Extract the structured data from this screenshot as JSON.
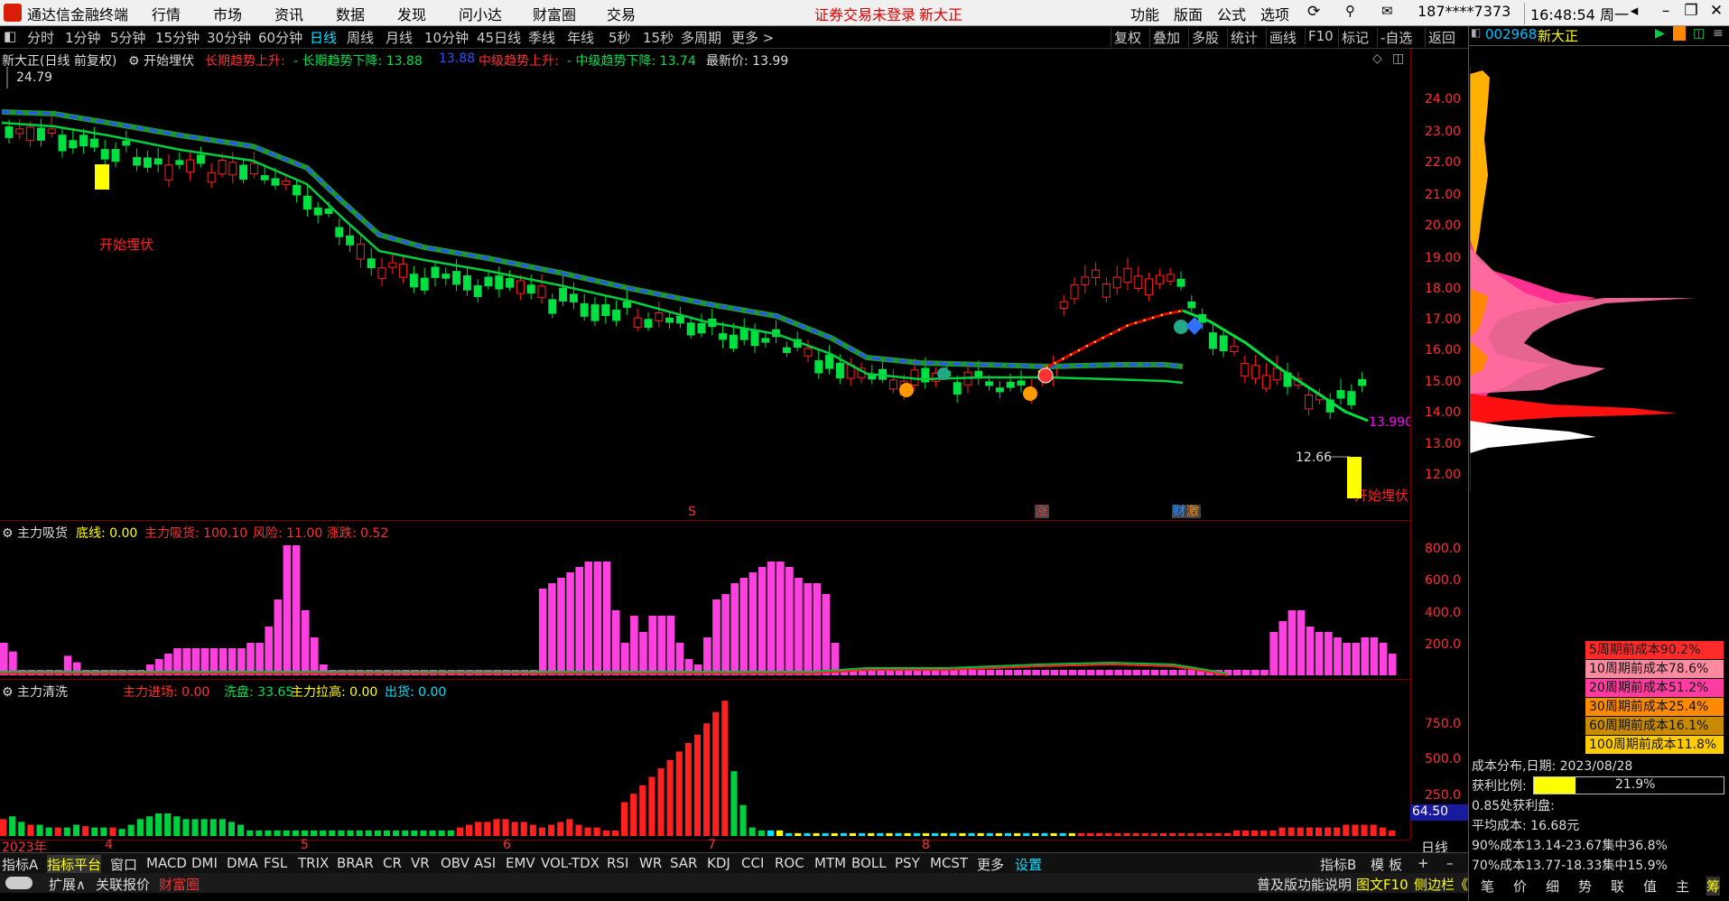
{
  "menubar": {
    "app_title": "通达信金融终端",
    "items": [
      "行情",
      "市场",
      "资讯",
      "数据",
      "发现",
      "问小达",
      "财富圈",
      "交易"
    ],
    "login_notice": "证券交易未登录",
    "stock_name": "新大正",
    "right_items": [
      "功能",
      "版面",
      "公式",
      "选项"
    ],
    "phone": "187****7373",
    "clock": "16:48:54 周一"
  },
  "periodbar": {
    "periods": [
      "分时",
      "1分钟",
      "5分钟",
      "15分钟",
      "30分钟",
      "60分钟",
      "日线",
      "周线",
      "月线",
      "10分钟",
      "45日线",
      "季线",
      "年线",
      "5秒",
      "15秒",
      "多周期",
      "更多 >"
    ],
    "active": "日线",
    "right_buttons": [
      "复权",
      "叠加",
      "多股",
      "统计",
      "画线",
      "F10",
      "标记",
      "-自选",
      "返回"
    ]
  },
  "main_chart": {
    "title": "新大正(日线 前复权)",
    "indicator": "开始埋伏",
    "legend": [
      {
        "text": "长期趋势上升:",
        "color": "#ff3030"
      },
      {
        "text": "- 长期趋势下降: 13.88",
        "color": "#00e050"
      },
      {
        "text": "13.88",
        "color": "#3050ff"
      },
      {
        "text": "中级趋势上升:",
        "color": "#ff3030"
      },
      {
        "text": "- 中级趋势下降: 13.74",
        "color": "#00e050"
      },
      {
        "text": "最新价: 13.99",
        "color": "#dddddd"
      }
    ],
    "high_label": "24.79",
    "low_label": "12.66",
    "last_label": "13.990",
    "signal_labels": [
      "开始埋伏",
      "开始埋伏"
    ],
    "event_markers": [
      "S",
      "涨",
      "财",
      "激"
    ],
    "y_ticks": [
      "24.00",
      "23.00",
      "22.00",
      "21.00",
      "20.00",
      "19.00",
      "18.00",
      "17.00",
      "16.00",
      "15.00",
      "14.00",
      "13.00",
      "12.00"
    ]
  },
  "panel2": {
    "name": "主力吸货",
    "legend": [
      {
        "text": "底线: 0.00",
        "color": "#ffff00"
      },
      {
        "text": "主力吸货: 100.10",
        "color": "#ff3030"
      },
      {
        "text": "风险: 11.00",
        "color": "#ff3030"
      },
      {
        "text": "涨跌: 0.52",
        "color": "#ff3030"
      }
    ],
    "y_ticks": [
      "800.0",
      "600.0",
      "400.0",
      "200.0"
    ],
    "values": [
      30,
      22,
      5,
      5,
      5,
      5,
      5,
      18,
      12,
      5,
      5,
      5,
      5,
      5,
      5,
      5,
      10,
      15,
      20,
      25,
      25,
      25,
      25,
      25,
      25,
      25,
      25,
      30,
      30,
      45,
      70,
      120,
      120,
      60,
      35,
      10,
      5,
      5,
      5,
      5,
      5,
      5,
      5,
      5,
      5,
      5,
      5,
      5,
      5,
      5,
      5,
      5,
      5,
      5,
      5,
      5,
      5,
      5,
      5,
      80,
      85,
      90,
      95,
      100,
      105,
      105,
      105,
      60,
      30,
      55,
      40,
      55,
      55,
      55,
      30,
      15,
      10,
      35,
      70,
      75,
      85,
      90,
      95,
      100,
      105,
      105,
      100,
      90,
      85,
      85,
      75,
      30,
      5,
      5,
      5,
      5,
      5,
      5,
      5,
      5,
      5,
      5,
      5,
      5,
      5,
      5,
      5,
      5,
      5,
      5,
      5,
      5,
      5,
      5,
      5,
      5,
      5,
      5,
      5,
      5,
      5,
      5,
      5,
      5,
      5,
      5,
      5,
      5,
      5,
      5,
      5,
      5,
      5,
      5,
      5,
      5,
      5,
      5,
      5,
      40,
      50,
      60,
      60,
      45,
      40,
      40,
      35,
      30,
      30,
      35,
      35,
      30,
      20
    ]
  },
  "panel3": {
    "name": "主力清洗",
    "legend": [
      {
        "text": "主力进场: 0.00",
        "color": "#ff3030"
      },
      {
        "text": "洗盘: 33.65",
        "color": "#00e050"
      },
      {
        "text": "主力拉高: 0.00",
        "color": "#ffff00"
      },
      {
        "text": "出货: 0.00",
        "color": "#00e0ff"
      }
    ],
    "y_ticks": [
      "750.0",
      "500.0",
      "250.0"
    ],
    "cursor_value": "64.50",
    "values": [
      12,
      14,
      10,
      8,
      8,
      6,
      6,
      6,
      8,
      7,
      6,
      6,
      6,
      5,
      8,
      12,
      14,
      16,
      16,
      14,
      12,
      12,
      12,
      12,
      12,
      10,
      8,
      4,
      4,
      4,
      4,
      4,
      4,
      4,
      4,
      4,
      4,
      4,
      4,
      4,
      4,
      4,
      4,
      4,
      4,
      4,
      4,
      4,
      4,
      4,
      6,
      8,
      10,
      10,
      12,
      12,
      10,
      10,
      8,
      6,
      8,
      10,
      12,
      8,
      6,
      6,
      4,
      4,
      24,
      30,
      36,
      42,
      48,
      54,
      60,
      66,
      72,
      80,
      88,
      96,
      46,
      22,
      6,
      4,
      4,
      4,
      2,
      2,
      2,
      2,
      2,
      2,
      2,
      2,
      2,
      2,
      2,
      2,
      2,
      2,
      2,
      2,
      2,
      2,
      2,
      2,
      2,
      2,
      2,
      2,
      2,
      2,
      2,
      2,
      2,
      2,
      2,
      2,
      2,
      2,
      2,
      2,
      2,
      2,
      2,
      2,
      2,
      2,
      2,
      2,
      2,
      2,
      2,
      2,
      2,
      4,
      4,
      4,
      4,
      4,
      6,
      6,
      6,
      6,
      6,
      6,
      6,
      8,
      8,
      8,
      8,
      6,
      4
    ]
  },
  "xaxis": {
    "labels": [
      {
        "t": "2023年",
        "x": 2
      },
      {
        "t": "4",
        "x": 116
      },
      {
        "t": "5",
        "x": 333
      },
      {
        "t": "6",
        "x": 557
      },
      {
        "t": "7",
        "x": 784
      },
      {
        "t": "8",
        "x": 1021
      }
    ],
    "right_label": "日线"
  },
  "indicator_tabs": {
    "left": [
      "指标A",
      "指标平台",
      "窗口"
    ],
    "items": [
      "MACD",
      "DMI",
      "DMA",
      "FSL",
      "TRIX",
      "BRAR",
      "CR",
      "VR",
      "OBV",
      "ASI",
      "EMV",
      "VOL-TDX",
      "RSI",
      "WR",
      "SAR",
      "KDJ",
      "CCI",
      "ROC",
      "MTM",
      "BOLL",
      "PSY",
      "MCST",
      "更多",
      "设置"
    ],
    "right": [
      "指标B",
      "模",
      "板"
    ]
  },
  "statusbar": {
    "left": [
      "扩展∧",
      "关联报价",
      "财富圈"
    ],
    "right": [
      "普及版功能说明",
      "图文F10",
      "侧边栏《"
    ]
  },
  "sidebar": {
    "code": "002968",
    "name": "新大正",
    "chip_rows": [
      {
        "text": "5周期前成本90.2%",
        "bg": "#ff2a2a"
      },
      {
        "text": "10周期前成本78.6%",
        "bg": "#ff8aa0"
      },
      {
        "text": "20周期前成本51.2%",
        "bg": "#ff3ca0"
      },
      {
        "text": "30周期前成本25.4%",
        "bg": "#ff8a00"
      },
      {
        "text": "60周期前成本16.1%",
        "bg": "#c88a00"
      },
      {
        "text": "100周期前成本11.8%",
        "bg": "#ffcc00"
      }
    ],
    "cost_title": "成本分布,日期: 2023/08/28",
    "profit_label": "获利比例:",
    "profit_value": "21.9%",
    "profit_pct": 21.9,
    "profit_line": "0.85处获利盘:",
    "avg_cost": "平均成本: 16.68元",
    "cost90": "90%成本13.14-23.67集中36.8%",
    "cost70": "70%成本13.77-18.33集中15.9%",
    "bottom_tabs": [
      "笔",
      "价",
      "细",
      "势",
      "联",
      "值",
      "主",
      "筹"
    ]
  }
}
